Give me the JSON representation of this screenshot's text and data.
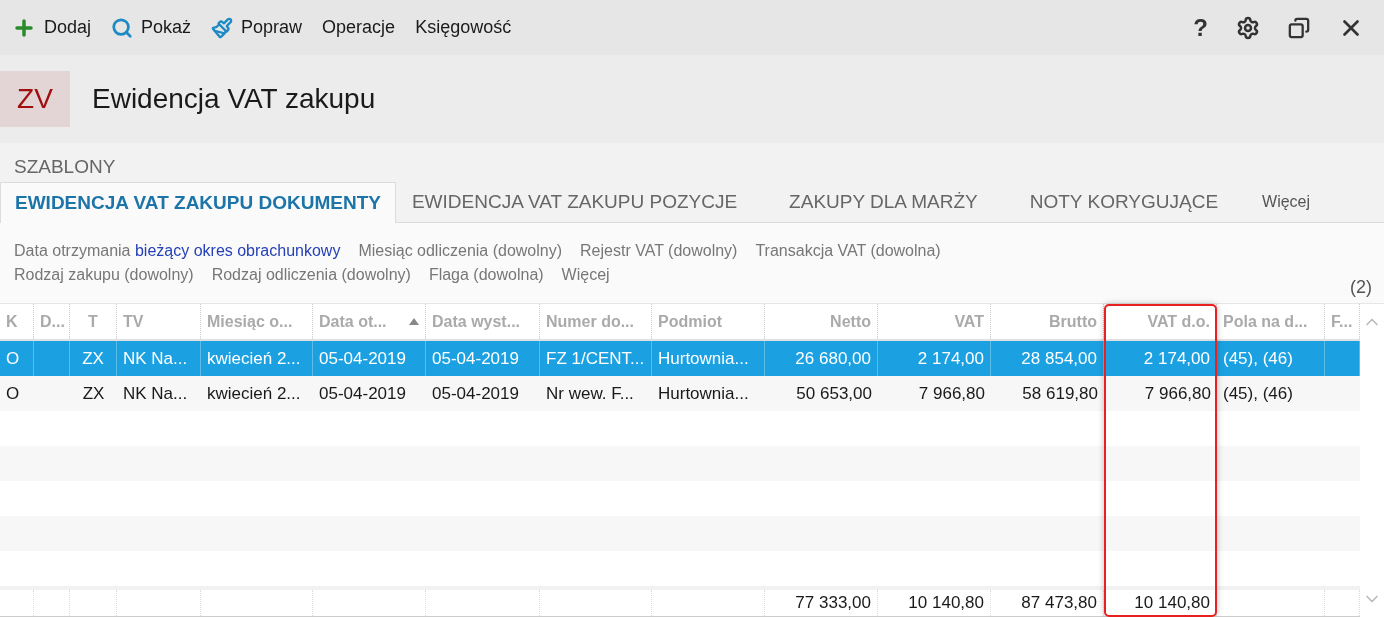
{
  "toolbar": {
    "items": [
      {
        "kind": "add",
        "label": "Dodaj"
      },
      {
        "kind": "show",
        "label": "Pokaż"
      },
      {
        "kind": "edit",
        "label": "Popraw"
      },
      {
        "kind": "plain",
        "label": "Operacje"
      },
      {
        "kind": "plain",
        "label": "Księgowość"
      }
    ],
    "help": "?"
  },
  "header": {
    "badge": "ZV",
    "title": "Ewidencja VAT zakupu"
  },
  "templates_label": "SZABLONY",
  "tabs": [
    {
      "label": "EWIDENCJA VAT ZAKUPU DOKUMENTY",
      "selected": true
    },
    {
      "label": "EWIDENCJA VAT ZAKUPU POZYCJE",
      "selected": false
    },
    {
      "label": "ZAKUPY DLA MARŻY",
      "selected": false
    },
    {
      "label": "NOTY KORYGUJĄCE",
      "selected": false
    }
  ],
  "tabs_more": "Więcej",
  "filters": [
    [
      {
        "label": "Data otrzymania",
        "value": "bieżący okres obrachunkowy"
      },
      {
        "label": "Miesiąc odliczenia (dowolny)"
      },
      {
        "label": "Rejestr VAT (dowolny)"
      },
      {
        "label": "Transakcja VAT (dowolna)"
      }
    ],
    [
      {
        "label": "Rodzaj zakupu (dowolny)"
      },
      {
        "label": "Rodzaj odliczenia (dowolny)"
      },
      {
        "label": "Flaga (dowolna)"
      },
      {
        "label": "Więcej"
      }
    ]
  ],
  "count": "(2)",
  "table": {
    "columns": [
      {
        "label": "K"
      },
      {
        "label": "D..."
      },
      {
        "label": "T"
      },
      {
        "label": "TV"
      },
      {
        "label": "Miesiąc o..."
      },
      {
        "label": "Data ot...",
        "sorted_ascending": true
      },
      {
        "label": "Data wyst..."
      },
      {
        "label": "Numer do..."
      },
      {
        "label": "Podmiot"
      },
      {
        "label": "Netto",
        "total": "77 333,00"
      },
      {
        "label": "VAT",
        "total": "10 140,80"
      },
      {
        "label": "Brutto",
        "total": "87 473,80"
      },
      {
        "label": "VAT d.o.",
        "total": "10 140,80",
        "highlighted": true
      },
      {
        "label": "Pola na d..."
      },
      {
        "label": "F..."
      }
    ],
    "rows": [
      {
        "selected": true,
        "cells": [
          "O",
          null,
          "ZX",
          "NK Na...",
          "kwiecień 2...",
          "05-04-2019",
          "05-04-2019",
          "FZ 1/CENT...",
          "Hurtownia...",
          "26 680,00",
          "2 174,00",
          "28 854,00",
          "2 174,00",
          "(45), (46)",
          null
        ]
      },
      {
        "selected": false,
        "cells": [
          "O",
          null,
          "ZX",
          "NK Na...",
          "kwiecień 2...",
          "05-04-2019",
          "05-04-2019",
          "Nr wew. F...",
          "Hurtownia...",
          "50 653,00",
          "7 966,80",
          "58 619,80",
          "7 966,80",
          "(45), (46)",
          null
        ]
      }
    ]
  }
}
